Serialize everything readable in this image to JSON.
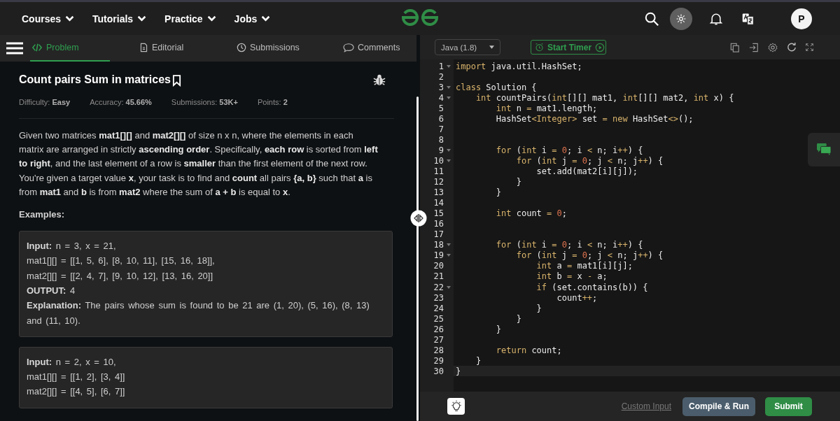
{
  "nav": {
    "menus": [
      {
        "label": "Courses"
      },
      {
        "label": "Tutorials"
      },
      {
        "label": "Practice"
      },
      {
        "label": "Jobs"
      }
    ],
    "avatar": "P"
  },
  "problem_tabs": [
    {
      "label": "Problem",
      "selected": true
    },
    {
      "label": "Editorial",
      "selected": false
    },
    {
      "label": "Submissions",
      "selected": false
    },
    {
      "label": "Comments",
      "selected": false
    }
  ],
  "problem": {
    "title": "Count pairs Sum in matrices",
    "meta": [
      "Difficulty: **Easy**",
      "Accuracy: **45.66%**",
      "Submissions: **53K+**",
      "Points: **2**"
    ],
    "description": [
      "Given two matrices **mat1[][]** and **mat2[][]** of size n x n, where the elements in each matrix are arranged in strictly **ascending order**. Specifically, **each row** is sorted from **left to right**, and the last element of a row is **smaller** than the first element of the next row.",
      "You're given a target value **x**, your task is to find and **count** all pairs **{a, b}** such that **a** is from **mat1** and **b** is from **mat2** where the sum of **a + b** is equal to **x**."
    ],
    "examples_heading": "Examples:",
    "examples": [
      [
        "**Input:** n = 3, x = 21,",
        "mat1[][] = [[1, 5, 6], [8, 10, 11], [15, 16, 18]],",
        "mat2[][] = [[2, 4, 7], [9, 10, 12], [13, 16, 20]]",
        "**OUTPUT:** 4",
        "**Explanation:** The pairs whose sum is found to be 21 are (1, 20), (5, 16), (8, 13) and (11, 10)."
      ],
      [
        "**Input:** n = 2, x = 10,",
        "mat1[][] = [[1, 2], [3, 4]]",
        "mat2[][] = [[4, 5], [6, 7]]"
      ]
    ]
  },
  "editor": {
    "language": "Java (1.8)",
    "timer_button": "Start Timer",
    "lines": [
      {
        "n": "1",
        "fold": true,
        "current": false,
        "tokens": [
          {
            "kind": "keyword",
            "text": "import"
          },
          {
            "kind": "plain",
            "text": " java.util.HashSet;"
          }
        ]
      },
      {
        "n": "2",
        "fold": false,
        "current": false
      },
      {
        "n": "3",
        "fold": true,
        "current": false,
        "tokens": [
          {
            "kind": "keyword",
            "text": "class"
          },
          {
            "kind": "plain",
            "text": " Solution {"
          }
        ]
      },
      {
        "n": "4",
        "fold": true,
        "current": false,
        "tokens": [
          {
            "kind": "keyword",
            "text": "    int"
          },
          {
            "kind": "plain",
            "text": " countPairs("
          },
          {
            "kind": "keyword",
            "text": "int"
          },
          {
            "kind": "plain",
            "text": "[][] mat1, "
          },
          {
            "kind": "keyword",
            "text": "int"
          },
          {
            "kind": "plain",
            "text": "[][] mat2, "
          },
          {
            "kind": "keyword",
            "text": "int"
          },
          {
            "kind": "plain",
            "text": " x) {"
          }
        ]
      },
      {
        "n": "5",
        "fold": false,
        "current": false,
        "tokens": [
          {
            "kind": "keyword",
            "text": "        int"
          },
          {
            "kind": "plain",
            "text": " n "
          },
          {
            "kind": "operator",
            "text": "="
          },
          {
            "kind": "plain",
            "text": " mat1.length;"
          }
        ]
      },
      {
        "n": "6",
        "fold": false,
        "current": false,
        "tokens": [
          {
            "kind": "plain",
            "text": "        HashSet"
          },
          {
            "kind": "operator",
            "text": "<Integer>"
          },
          {
            "kind": "plain",
            "text": " set "
          },
          {
            "kind": "operator",
            "text": "="
          },
          {
            "kind": "keyword",
            "text": " new"
          },
          {
            "kind": "plain",
            "text": " HashSet"
          },
          {
            "kind": "operator",
            "text": "<>"
          },
          {
            "kind": "plain",
            "text": "();"
          }
        ]
      },
      {
        "n": "7",
        "fold": false,
        "current": false
      },
      {
        "n": "8",
        "fold": false,
        "current": false
      },
      {
        "n": "9",
        "fold": true,
        "current": false,
        "tokens": [
          {
            "kind": "keyword",
            "text": "        for"
          },
          {
            "kind": "plain",
            "text": " ("
          },
          {
            "kind": "keyword",
            "text": "int"
          },
          {
            "kind": "plain",
            "text": " i "
          },
          {
            "kind": "operator",
            "text": "="
          },
          {
            "kind": "number",
            "text": " 0"
          },
          {
            "kind": "plain",
            "text": "; i "
          },
          {
            "kind": "operator",
            "text": "<"
          },
          {
            "kind": "plain",
            "text": " n; i"
          },
          {
            "kind": "operator",
            "text": "++"
          },
          {
            "kind": "plain",
            "text": ") {"
          }
        ]
      },
      {
        "n": "10",
        "fold": true,
        "current": false,
        "tokens": [
          {
            "kind": "keyword",
            "text": "            for"
          },
          {
            "kind": "plain",
            "text": " ("
          },
          {
            "kind": "keyword",
            "text": "int"
          },
          {
            "kind": "plain",
            "text": " j "
          },
          {
            "kind": "operator",
            "text": "="
          },
          {
            "kind": "number",
            "text": " 0"
          },
          {
            "kind": "plain",
            "text": "; j "
          },
          {
            "kind": "operator",
            "text": "<"
          },
          {
            "kind": "plain",
            "text": " n; j"
          },
          {
            "kind": "operator",
            "text": "++"
          },
          {
            "kind": "plain",
            "text": ") {"
          }
        ]
      },
      {
        "n": "11",
        "fold": false,
        "current": false,
        "tokens": [
          {
            "kind": "plain",
            "text": "                set.add(mat2[i][j]);"
          }
        ]
      },
      {
        "n": "12",
        "fold": false,
        "current": false,
        "tokens": [
          {
            "kind": "plain",
            "text": "            }"
          }
        ]
      },
      {
        "n": "13",
        "fold": false,
        "current": false,
        "tokens": [
          {
            "kind": "plain",
            "text": "        }"
          }
        ]
      },
      {
        "n": "14",
        "fold": false,
        "current": false
      },
      {
        "n": "15",
        "fold": false,
        "current": false,
        "tokens": [
          {
            "kind": "keyword",
            "text": "        int"
          },
          {
            "kind": "plain",
            "text": " count "
          },
          {
            "kind": "operator",
            "text": "="
          },
          {
            "kind": "number",
            "text": " 0"
          },
          {
            "kind": "plain",
            "text": ";"
          }
        ]
      },
      {
        "n": "16",
        "fold": false,
        "current": false
      },
      {
        "n": "17",
        "fold": false,
        "current": false
      },
      {
        "n": "18",
        "fold": true,
        "current": false,
        "tokens": [
          {
            "kind": "keyword",
            "text": "        for"
          },
          {
            "kind": "plain",
            "text": " ("
          },
          {
            "kind": "keyword",
            "text": "int"
          },
          {
            "kind": "plain",
            "text": " i "
          },
          {
            "kind": "operator",
            "text": "="
          },
          {
            "kind": "number",
            "text": " 0"
          },
          {
            "kind": "plain",
            "text": "; i "
          },
          {
            "kind": "operator",
            "text": "<"
          },
          {
            "kind": "plain",
            "text": " n; i"
          },
          {
            "kind": "operator",
            "text": "++"
          },
          {
            "kind": "plain",
            "text": ") {"
          }
        ]
      },
      {
        "n": "19",
        "fold": true,
        "current": false,
        "tokens": [
          {
            "kind": "keyword",
            "text": "            for"
          },
          {
            "kind": "plain",
            "text": " ("
          },
          {
            "kind": "keyword",
            "text": "int"
          },
          {
            "kind": "plain",
            "text": " j "
          },
          {
            "kind": "operator",
            "text": "="
          },
          {
            "kind": "number",
            "text": " 0"
          },
          {
            "kind": "plain",
            "text": "; j "
          },
          {
            "kind": "operator",
            "text": "<"
          },
          {
            "kind": "plain",
            "text": " n; j"
          },
          {
            "kind": "operator",
            "text": "++"
          },
          {
            "kind": "plain",
            "text": ") {"
          }
        ]
      },
      {
        "n": "20",
        "fold": false,
        "current": false,
        "tokens": [
          {
            "kind": "keyword",
            "text": "                int"
          },
          {
            "kind": "plain",
            "text": " a "
          },
          {
            "kind": "operator",
            "text": "="
          },
          {
            "kind": "plain",
            "text": " mat1[i][j];"
          }
        ]
      },
      {
        "n": "21",
        "fold": false,
        "current": false,
        "tokens": [
          {
            "kind": "keyword",
            "text": "                int"
          },
          {
            "kind": "plain",
            "text": " b "
          },
          {
            "kind": "operator",
            "text": "="
          },
          {
            "kind": "plain",
            "text": " x "
          },
          {
            "kind": "operator",
            "text": "-"
          },
          {
            "kind": "plain",
            "text": " a;"
          }
        ]
      },
      {
        "n": "22",
        "fold": true,
        "current": false,
        "tokens": [
          {
            "kind": "keyword",
            "text": "                if"
          },
          {
            "kind": "plain",
            "text": " (set.contains(b)) {"
          }
        ]
      },
      {
        "n": "23",
        "fold": false,
        "current": false,
        "tokens": [
          {
            "kind": "plain",
            "text": "                    count"
          },
          {
            "kind": "operator",
            "text": "++"
          },
          {
            "kind": "plain",
            "text": ";"
          }
        ]
      },
      {
        "n": "24",
        "fold": false,
        "current": false,
        "tokens": [
          {
            "kind": "plain",
            "text": "                }"
          }
        ]
      },
      {
        "n": "25",
        "fold": false,
        "current": false,
        "tokens": [
          {
            "kind": "plain",
            "text": "            }"
          }
        ]
      },
      {
        "n": "26",
        "fold": false,
        "current": false,
        "tokens": [
          {
            "kind": "plain",
            "text": "        }"
          }
        ]
      },
      {
        "n": "27",
        "fold": false,
        "current": false
      },
      {
        "n": "28",
        "fold": false,
        "current": false,
        "tokens": [
          {
            "kind": "keyword",
            "text": "        return"
          },
          {
            "kind": "plain",
            "text": " count;"
          }
        ]
      },
      {
        "n": "29",
        "fold": false,
        "current": false,
        "tokens": [
          {
            "kind": "plain",
            "text": "    }"
          }
        ]
      },
      {
        "n": "30",
        "fold": false,
        "current": true,
        "tokens": [
          {
            "kind": "plain",
            "text": "}"
          }
        ]
      }
    ]
  },
  "footer": {
    "custom_input": "Custom Input",
    "compile_button": "Compile & Run",
    "submit_button": "Submit"
  }
}
